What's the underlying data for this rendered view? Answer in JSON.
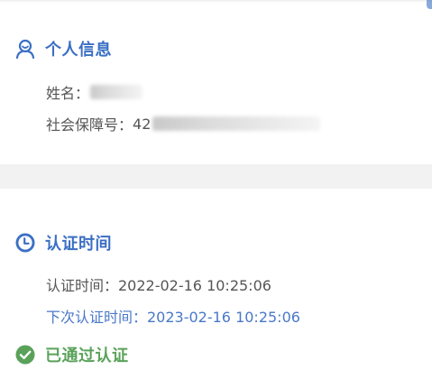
{
  "personal_info": {
    "title": "个人信息",
    "name_label": "姓名：",
    "name_prefix": "",
    "ssn_label": "社会保障号：",
    "ssn_prefix": "42"
  },
  "auth_time": {
    "title": "认证时间",
    "auth_time_text": "认证时间：2022-02-16 10:25:06",
    "next_auth_time_text": "下次认证时间：2023-02-16 10:25:06"
  },
  "status": {
    "verified_text": "已通过认证"
  },
  "icons": {
    "person": "person-icon",
    "clock": "clock-icon",
    "check": "check-circle-icon"
  },
  "colors": {
    "accent_blue": "#3b6fc4",
    "link_blue": "#4a78c8",
    "success_green": "#5aa25a",
    "text_gray": "#555555",
    "divider_gray": "#f2f2f2"
  }
}
